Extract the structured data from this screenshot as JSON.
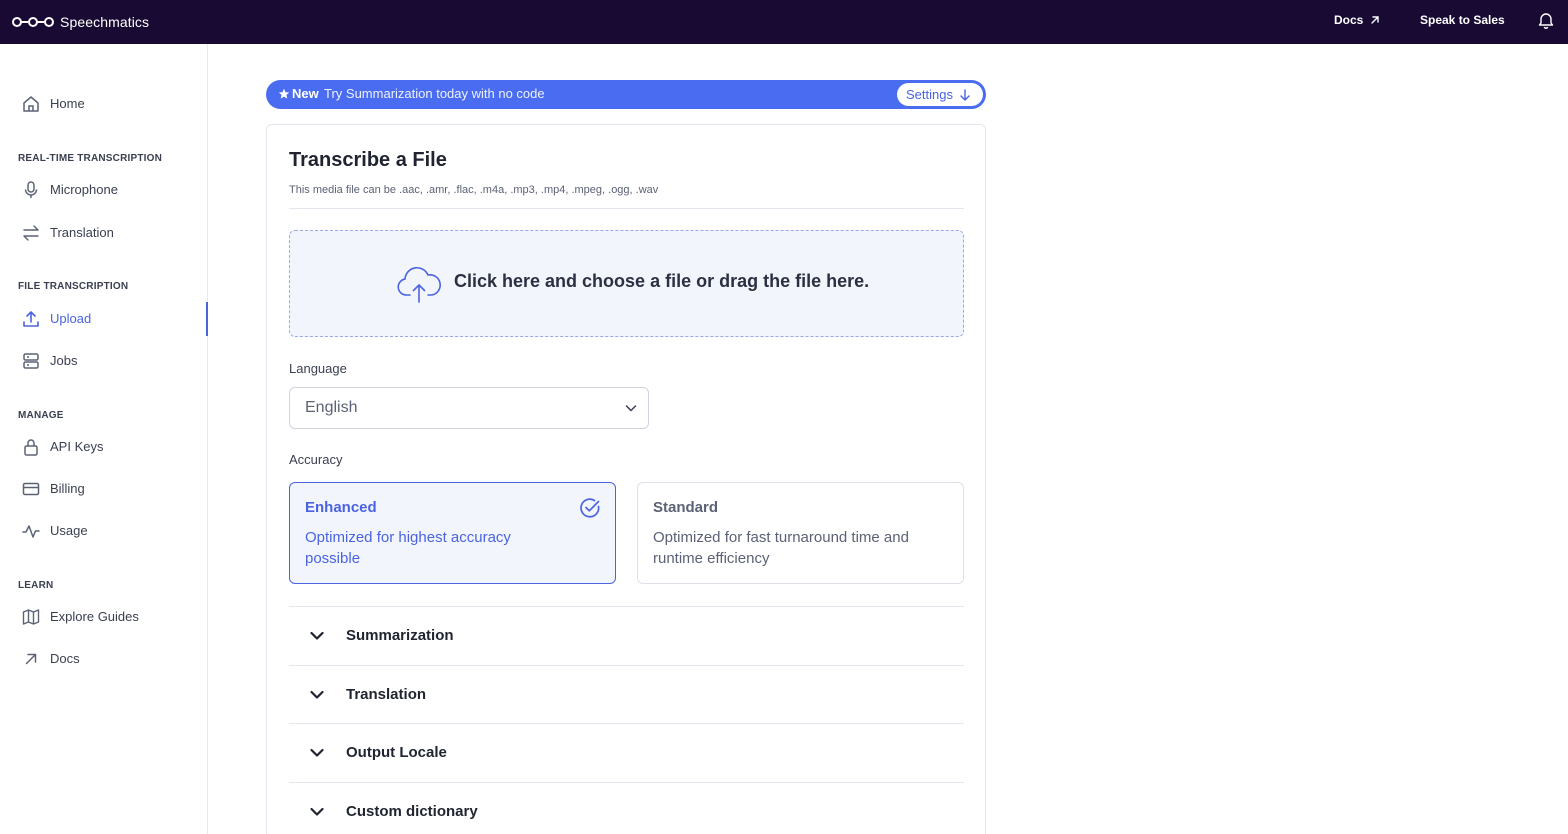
{
  "topbar": {
    "brand": "Speechmatics",
    "docs_label": "Docs",
    "sales_label": "Speak to Sales"
  },
  "sidebar": {
    "home": "Home",
    "sections": {
      "realtime": "REAL-TIME TRANSCRIPTION",
      "file": "FILE TRANSCRIPTION",
      "manage": "MANAGE",
      "learn": "LEARN"
    },
    "items": {
      "microphone": "Microphone",
      "translation": "Translation",
      "upload": "Upload",
      "jobs": "Jobs",
      "api_keys": "API Keys",
      "billing": "Billing",
      "usage": "Usage",
      "explore_guides": "Explore Guides",
      "docs": "Docs"
    },
    "active": "Upload"
  },
  "banner": {
    "new_label": "New",
    "text": "Try Summarization today with no code",
    "button_label": "Settings"
  },
  "card": {
    "title": "Transcribe a File",
    "subtitle": "This media file can be .aac, .amr, .flac, .m4a, .mp3, .mp4, .mpeg, .ogg, .wav",
    "dropzone_text": "Click here and choose a file or drag the file here.",
    "language_label": "Language",
    "language_value": "English",
    "accuracy_label": "Accuracy",
    "accuracy_options": [
      {
        "title": "Enhanced",
        "description": "Optimized for highest accuracy possible",
        "selected": true
      },
      {
        "title": "Standard",
        "description": "Optimized for fast turnaround time and runtime efficiency",
        "selected": false
      }
    ],
    "accordions": [
      "Summarization",
      "Translation",
      "Output Locale",
      "Custom dictionary"
    ]
  },
  "colors": {
    "topbar_bg": "#180a33",
    "accent": "#4a63e0",
    "banner_bg": "#4a6cf0"
  }
}
